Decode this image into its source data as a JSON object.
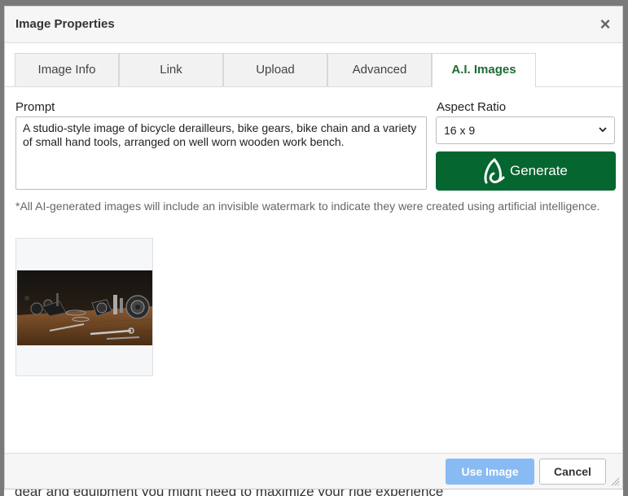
{
  "dialog": {
    "title": "Image Properties",
    "close_icon": "close-icon"
  },
  "tabs": [
    {
      "label": "Image Info",
      "active": false
    },
    {
      "label": "Link",
      "active": false
    },
    {
      "label": "Upload",
      "active": false
    },
    {
      "label": "Advanced",
      "active": false
    },
    {
      "label": "A.I. Images",
      "active": true
    }
  ],
  "prompt": {
    "label": "Prompt",
    "value": "A studio-style image of bicycle derailleurs, bike gears, bike chain and a variety of small hand tools, arranged on well worn wooden work bench."
  },
  "aspect_ratio": {
    "label": "Aspect Ratio",
    "selected": "16 x 9"
  },
  "generate": {
    "label": "Generate",
    "icon": "ai-logo-icon"
  },
  "disclaimer": "*All AI-generated images will include an invisible watermark to indicate they were created using artificial intelligence.",
  "footer": {
    "use_image_label": "Use Image",
    "cancel_label": "Cancel"
  },
  "background_text": "gear and equipment you might need to maximize your ride experience",
  "colors": {
    "accent_green": "#05662f",
    "active_tab_text": "#1f6b35",
    "use_button_disabled": "#88bbf4"
  }
}
